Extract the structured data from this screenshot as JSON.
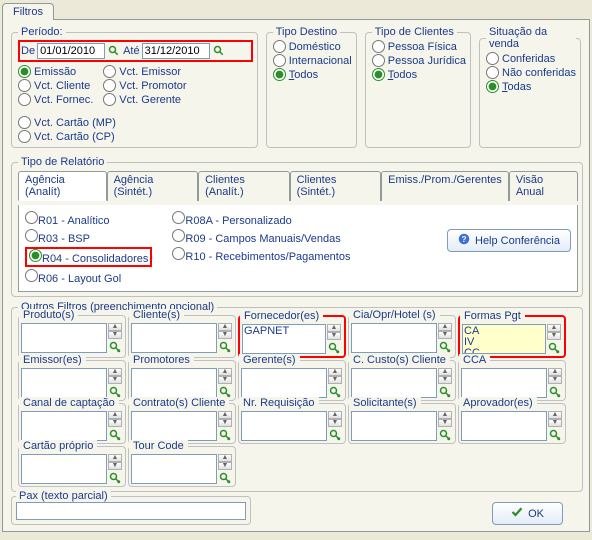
{
  "main_tab": "Filtros",
  "periodo": {
    "legend": "Período:",
    "de": "De",
    "ate": "Até",
    "date_from": "01/01/2010",
    "date_to": "31/12/2010",
    "opts_col1": [
      "Emissão",
      "Vct. Cliente",
      "Vct. Fornec."
    ],
    "opts_col2": [
      "Vct. Emissor",
      "Vct. Promotor",
      "Vct. Gerente"
    ],
    "opts_col3": [
      "Vct. Cartão (MP)",
      "Vct. Cartão (CP)"
    ]
  },
  "tipo_destino": {
    "legend": "Tipo Destino",
    "opts": [
      "Doméstico",
      "Internacional",
      "Todos"
    ]
  },
  "tipo_clientes": {
    "legend": "Tipo de Clientes",
    "opts": [
      "Pessoa Física",
      "Pessoa Jurídica",
      "Todos"
    ]
  },
  "situacao": {
    "legend": "Situação da venda",
    "opts": [
      "Conferidas",
      "Não conferidas",
      "Todas"
    ]
  },
  "tipo_relatorio": {
    "legend": "Tipo de Relatório",
    "tabs": [
      "Agência (Analít)",
      "Agência (Sintét.)",
      "Clientes (Analít.)",
      "Clientes (Sintét.)",
      "Emiss./Prom./Gerentes",
      "Visão Anual"
    ],
    "col1": [
      "R01 - Analítico",
      "R03 - BSP",
      "R04 - Consolidadores",
      "R06 - Layout Gol"
    ],
    "col2": [
      "R08A - Personalizado",
      "R09 - Campos Manuais/Vendas",
      "R10 - Recebimentos/Pagamentos"
    ],
    "help": "Help Conferência"
  },
  "outros": {
    "legend": "Outros Filtros (preenchimento opcional)",
    "boxes": [
      {
        "title": "Produto(s)",
        "val": ""
      },
      {
        "title": "Cliente(s)",
        "val": ""
      },
      {
        "title": "Fornecedor(es)",
        "val": "GAPNET",
        "red": true
      },
      {
        "title": "Cia/Opr/Hotel (s)",
        "val": ""
      },
      {
        "title": "Formas Pgt",
        "val": "CA\nIV\nCC",
        "red": true,
        "yellow": true
      },
      {
        "title": "Emissor(es)",
        "val": ""
      },
      {
        "title": "Promotores",
        "val": ""
      },
      {
        "title": "Gerente(s)",
        "val": ""
      },
      {
        "title": "C. Custo(s) Cliente",
        "val": ""
      },
      {
        "title": "CCA",
        "val": ""
      },
      {
        "title": "Canal de captação",
        "val": ""
      },
      {
        "title": "Contrato(s) Cliente",
        "val": ""
      },
      {
        "title": "Nr. Requisição",
        "val": ""
      },
      {
        "title": "Solicitante(s)",
        "val": ""
      },
      {
        "title": "Aprovador(es)",
        "val": ""
      },
      {
        "title": "Cartão próprio",
        "val": ""
      },
      {
        "title": "Tour Code",
        "val": ""
      }
    ]
  },
  "pax": {
    "legend": "Pax (texto parcial)",
    "value": ""
  },
  "ok": "OK"
}
